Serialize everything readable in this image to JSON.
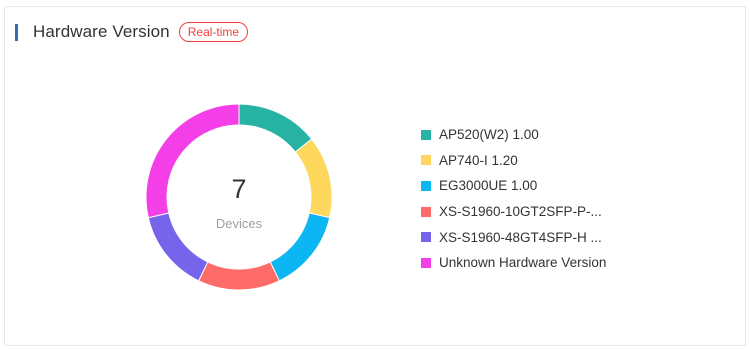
{
  "widget": {
    "title": "Hardware Version",
    "badge": "Real-time"
  },
  "center": {
    "count": "7",
    "label": "Devices"
  },
  "legend": [
    {
      "label": "AP520(W2) 1.00",
      "color": "#27b3a3"
    },
    {
      "label": "AP740-I 1.20",
      "color": "#fdd85d"
    },
    {
      "label": "EG3000UE 1.00",
      "color": "#0bb6f2"
    },
    {
      "label": "XS-S1960-10GT2SFP-P-...",
      "color": "#fe6b68"
    },
    {
      "label": "XS-S1960-48GT4SFP-H ...",
      "color": "#7665ea"
    },
    {
      "label": "Unknown Hardware Version",
      "color": "#f43ee7"
    }
  ],
  "chart_data": {
    "type": "pie",
    "categories": [
      "AP520(W2) 1.00",
      "AP740-I 1.20",
      "EG3000UE 1.00",
      "XS-S1960-10GT2SFP-P-...",
      "XS-S1960-48GT4SFP-H ...",
      "Unknown Hardware Version"
    ],
    "values": [
      1,
      1,
      1,
      1,
      1,
      2
    ],
    "colors": [
      "#27b3a3",
      "#fdd85d",
      "#0bb6f2",
      "#fe6b68",
      "#7665ea",
      "#f43ee7"
    ],
    "donut": true,
    "legend": "right"
  }
}
